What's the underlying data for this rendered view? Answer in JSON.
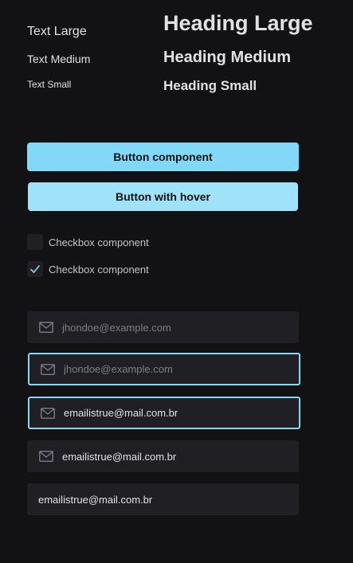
{
  "typography": {
    "text_large": "Text Large",
    "text_medium": "Text Medium",
    "text_small": "Text Small",
    "heading_large": "Heading Large",
    "heading_medium": "Heading Medium",
    "heading_small": "Heading Small"
  },
  "buttons": {
    "primary_label": "Button component",
    "hover_label": "Button with hover"
  },
  "checkboxes": [
    {
      "label": "Checkbox component",
      "checked": false
    },
    {
      "label": "Checkbox component",
      "checked": true
    }
  ],
  "inputs": [
    {
      "placeholder": "jhondoe@example.com",
      "value": "",
      "icon": "envelope-icon",
      "focused": false
    },
    {
      "placeholder": "jhondoe@example.com",
      "value": "",
      "icon": "envelope-icon",
      "focused": true
    },
    {
      "placeholder": "",
      "value": "emailistrue@mail.com.br",
      "icon": "envelope-icon",
      "focused": true
    },
    {
      "placeholder": "",
      "value": "emailistrue@mail.com.br",
      "icon": "envelope-icon",
      "focused": false
    },
    {
      "placeholder": "",
      "value": "emailistrue@mail.com.br",
      "icon": "",
      "focused": false
    }
  ],
  "colors": {
    "background": "#121214",
    "surface": "#202024",
    "accent": "#81d8f7",
    "accent_hover": "#a0e3f9",
    "text": "#e1e1e6",
    "placeholder": "#7c7c8a"
  }
}
